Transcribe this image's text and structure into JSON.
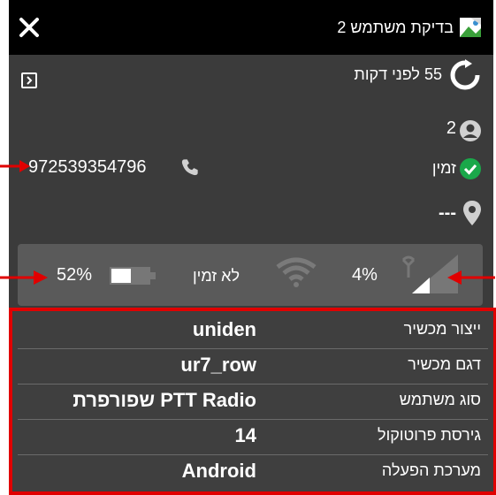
{
  "window": {
    "title": "בדיקת משתמש 2",
    "close_icon": "close-icon",
    "title_icon": "user-avatar-image-icon"
  },
  "header": {
    "last_update": "55 לפני דקות",
    "refresh_icon": "refresh-icon",
    "collapse_icon": "chevron-right-icon"
  },
  "user": {
    "id": "2",
    "status": "זמין",
    "phone": "972539354796",
    "location": "---"
  },
  "status_bar": {
    "battery": "52%",
    "wifi_status": "לא זמין",
    "signal": "4%"
  },
  "details": {
    "rows": [
      {
        "label": "ייצור מכשיר",
        "value": "uniden"
      },
      {
        "label": "דגם מכשיר",
        "value": "ur7_row"
      },
      {
        "label": "סוג משתמש",
        "value": "PTT Radio שפורפרת"
      },
      {
        "label": "גירסת פרוטוקול",
        "value": "14"
      },
      {
        "label": "מערכת הפעלה",
        "value": "Android"
      }
    ]
  },
  "colors": {
    "titlebar": "#000000",
    "panel": "#3b3b3b",
    "status_box": "#5a5a5a",
    "available_green": "#1aa84a",
    "annotation_red": "#e00000"
  }
}
